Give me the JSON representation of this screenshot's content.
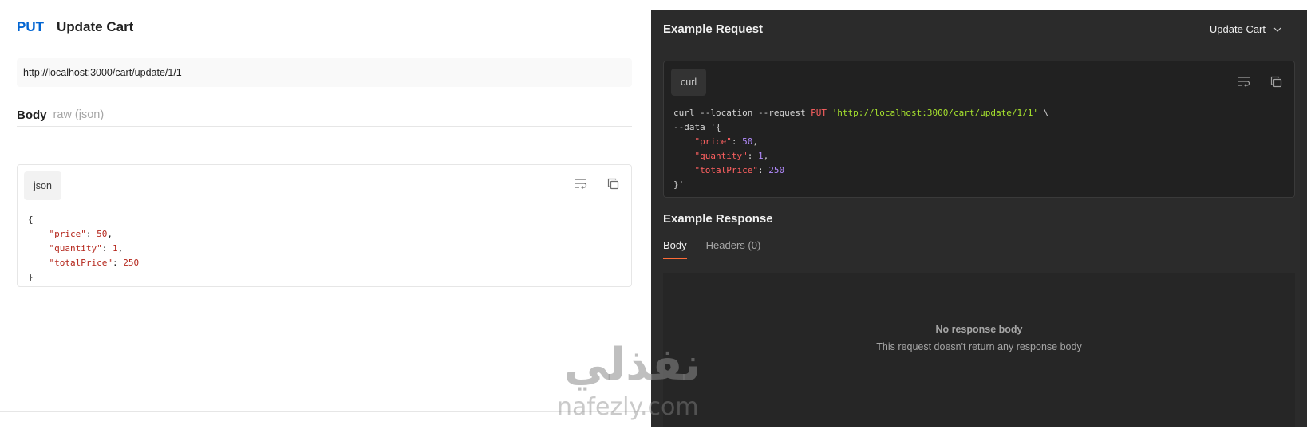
{
  "request": {
    "method": "PUT",
    "name": "Update Cart",
    "url": "http://localhost:3000/cart/update/1/1",
    "body_label": "Body",
    "body_type": "raw (json)",
    "code_lang": "json"
  },
  "example_request": {
    "title": "Example Request",
    "selected": "Update Cart",
    "lang": "curl"
  },
  "example_response": {
    "title": "Example Response",
    "tabs": [
      {
        "label": "Body"
      },
      {
        "label": "Headers (0)"
      }
    ],
    "empty_title": "No response body",
    "empty_subtitle": "This request doesn't return any response body"
  },
  "watermark": {
    "arabic": "نفذلي",
    "latin": "nafezly.com"
  },
  "colors": {
    "method": "#0265d2",
    "active_tab": "#ff6c37",
    "dark_panel": "#2b2b2b"
  }
}
